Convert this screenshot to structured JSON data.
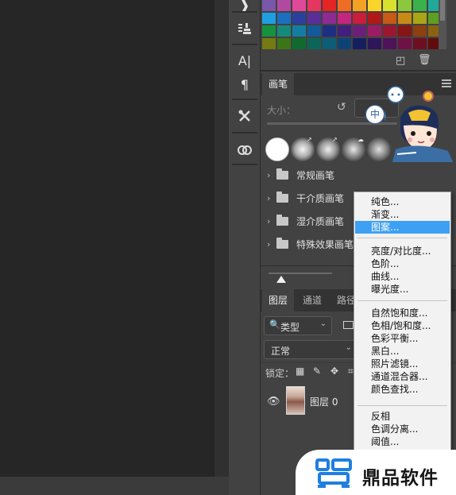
{
  "swatches": {
    "rows": [
      [
        "#7a57a8",
        "#b04aa0",
        "#e0489a",
        "#e63561",
        "#e52424",
        "#ef6c24",
        "#f4a223",
        "#f9d52a",
        "#d8e12d",
        "#8bc83c",
        "#3bb14a",
        "#21a89a"
      ],
      [
        "#1ea0e0",
        "#1c6fc0",
        "#2b3f9e",
        "#5a2e98",
        "#8e2a94",
        "#c2267e",
        "#c81e3c",
        "#b31818",
        "#c65a16",
        "#c88a16",
        "#aaa514",
        "#5e9e22"
      ],
      [
        "#16923e",
        "#168a7a",
        "#137ea2",
        "#135a9a",
        "#1c2f82",
        "#421f7c",
        "#6c1f7a",
        "#9b1c64",
        "#9c1630",
        "#881414",
        "#8e3f10",
        "#8a6212"
      ],
      [
        "#757a12",
        "#3c7418",
        "#0f6a30",
        "#0c6559",
        "#0d5d79",
        "#0d4374",
        "#151f60",
        "#2f155a",
        "#4e1358",
        "#6f1147",
        "#6e0e22",
        "#600c0c"
      ]
    ]
  },
  "brushes_panel": {
    "tab": "画笔",
    "size_label": "大小：",
    "folders": [
      {
        "label": "常规画笔"
      },
      {
        "label": "干介质画笔"
      },
      {
        "label": "湿介质画笔"
      },
      {
        "label": "特殊效果画笔"
      }
    ]
  },
  "layers_panel": {
    "tabs": [
      {
        "label": "图层"
      },
      {
        "label": "通道"
      },
      {
        "label": "路径"
      }
    ],
    "filter_value": "类型",
    "blend_mode": "正常",
    "lock_label": "锁定：",
    "layer_name": "图层 0"
  },
  "context_menu": {
    "items": [
      {
        "label": "纯色..."
      },
      {
        "label": "渐变..."
      },
      {
        "label": "图案..."
      },
      {
        "label": "亮度/对比度..."
      },
      {
        "label": "色阶..."
      },
      {
        "label": "曲线..."
      },
      {
        "label": "曝光度..."
      },
      {
        "label": "自然饱和度..."
      },
      {
        "label": "色相/饱和度..."
      },
      {
        "label": "色彩平衡..."
      },
      {
        "label": "黑白..."
      },
      {
        "label": "照片滤镜..."
      },
      {
        "label": "通道混合器..."
      },
      {
        "label": "颜色查找..."
      },
      {
        "label": "反相"
      },
      {
        "label": "色调分离..."
      },
      {
        "label": "阈值..."
      }
    ],
    "highlighted": "图案...",
    "highlight_color": "#3ea0f2"
  },
  "mascot": {
    "badge": "中"
  },
  "watermark": {
    "text": "鼎品软件",
    "brand_color": "#1e7fe0"
  }
}
